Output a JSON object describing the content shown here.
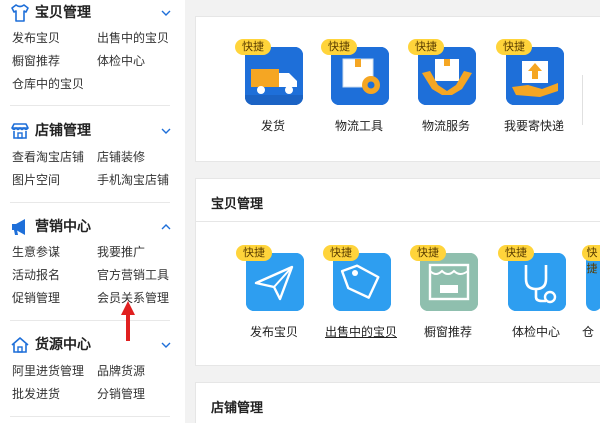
{
  "sidebar": {
    "sections": [
      {
        "id": "baby",
        "title": "宝贝管理",
        "icon": "shirt-icon",
        "expanded": false,
        "links": [
          "发布宝贝",
          "出售中的宝贝",
          "橱窗推荐",
          "体检中心",
          "仓库中的宝贝"
        ]
      },
      {
        "id": "shop",
        "title": "店铺管理",
        "icon": "shop-icon",
        "expanded": false,
        "links": [
          "查看淘宝店铺",
          "店铺装修",
          "图片空间",
          "手机淘宝店铺"
        ]
      },
      {
        "id": "marketing",
        "title": "营销中心",
        "icon": "megaphone-icon",
        "expanded": true,
        "links": [
          "生意参谋",
          "我要推广",
          "活动报名",
          "官方营销工具",
          "促销管理",
          "会员关系管理"
        ]
      },
      {
        "id": "source",
        "title": "货源中心",
        "icon": "house-icon",
        "expanded": false,
        "links": [
          "阿里进货管理",
          "品牌货源",
          "批发进货",
          "分销管理"
        ]
      }
    ]
  },
  "main": {
    "logistics": {
      "tiles": [
        {
          "badge": "快捷",
          "label": "发货",
          "icon": "truck-icon",
          "color": "#1e6fd9"
        },
        {
          "badge": "快捷",
          "label": "物流工具",
          "icon": "package-gear-icon",
          "color": "#1e6fd9"
        },
        {
          "badge": "快捷",
          "label": "物流服务",
          "icon": "hands-package-icon",
          "color": "#1e6fd9"
        },
        {
          "badge": "快捷",
          "label": "我要寄快递",
          "icon": "hand-package-icon",
          "color": "#1e6fd9"
        }
      ]
    },
    "baby_mgmt": {
      "title": "宝贝管理",
      "tiles": [
        {
          "badge": "快捷",
          "label": "发布宝贝",
          "icon": "paper-plane-icon",
          "color": "#2e9ef0"
        },
        {
          "badge": "快捷",
          "label": "出售中的宝贝",
          "icon": "price-tag-icon",
          "color": "#2e9ef0"
        },
        {
          "badge": "快捷",
          "label": "橱窗推荐",
          "icon": "showcase-icon",
          "color": "#8fbfae"
        },
        {
          "badge": "快捷",
          "label": "体检中心",
          "icon": "stethoscope-icon",
          "color": "#2e9ef0"
        },
        {
          "badge": "快捷",
          "label": "仓",
          "icon": "warehouse-icon",
          "color": "#2e9ef0"
        }
      ]
    },
    "shop_mgmt": {
      "title": "店铺管理"
    }
  },
  "colors": {
    "badge": "#ffd43b",
    "accent_blue": "#1e6fd9",
    "arrow_red": "#e02020"
  }
}
